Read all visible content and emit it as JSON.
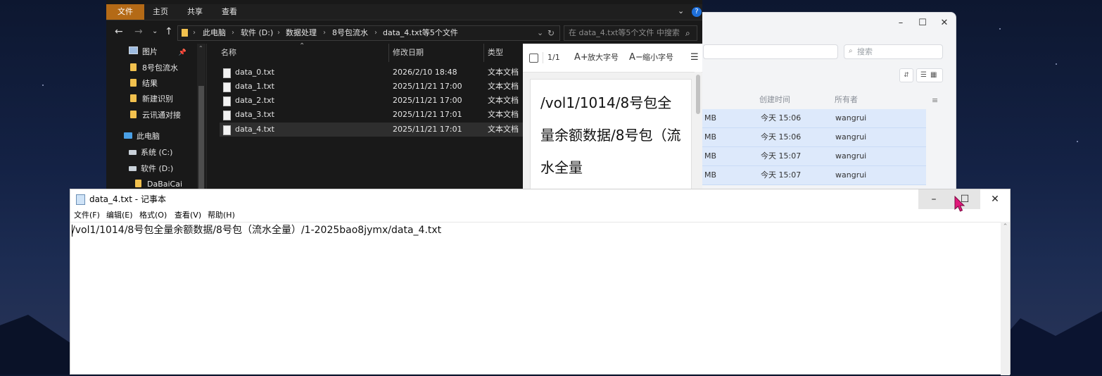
{
  "colors": {
    "accent_file_tab": "#b46a16",
    "explorer_bg": "#191919",
    "selection_row": "#dde9fb",
    "cursor": "#e0187a"
  },
  "background_window": {
    "search_placeholder": "搜索",
    "columns": [
      "创建时间",
      "所有者"
    ],
    "rows": [
      {
        "size": "MB",
        "created": "今天 15:06",
        "owner": "wangrui"
      },
      {
        "size": "MB",
        "created": "今天 15:06",
        "owner": "wangrui"
      },
      {
        "size": "MB",
        "created": "今天 15:07",
        "owner": "wangrui"
      },
      {
        "size": "MB",
        "created": "今天 15:07",
        "owner": "wangrui"
      }
    ],
    "controls": {
      "minimize": "–",
      "maximize": "☐",
      "close": "✕"
    }
  },
  "explorer": {
    "ribbon_tabs": [
      "文件",
      "主页",
      "共享",
      "查看"
    ],
    "breadcrumb": [
      "此电脑",
      "软件 (D:)",
      "数据处理",
      "8号包流水",
      "data_4.txt等5个文件"
    ],
    "search_placeholder": "在 data_4.txt等5个文件 中搜索",
    "sidebar": [
      {
        "label": "图片",
        "icon": "pictures-icon"
      },
      {
        "label": "8号包流水",
        "icon": "folder-icon"
      },
      {
        "label": "结果",
        "icon": "folder-icon"
      },
      {
        "label": "新建识别",
        "icon": "folder-icon"
      },
      {
        "label": "云讯通对接",
        "icon": "folder-icon"
      },
      {
        "label": "此电脑",
        "icon": "computer-icon"
      },
      {
        "label": "系统 (C:)",
        "icon": "drive-icon"
      },
      {
        "label": "软件 (D:)",
        "icon": "drive-icon"
      },
      {
        "label": "DaBaiCai",
        "icon": "folder-icon"
      }
    ],
    "columns": {
      "name": "名称",
      "date": "修改日期",
      "type": "类型"
    },
    "files": [
      {
        "name": "data_0.txt",
        "date": "2026/2/10 18:48",
        "type": "文本文档"
      },
      {
        "name": "data_1.txt",
        "date": "2025/11/21 17:00",
        "type": "文本文档"
      },
      {
        "name": "data_2.txt",
        "date": "2025/11/21 17:00",
        "type": "文本文档"
      },
      {
        "name": "data_3.txt",
        "date": "2025/11/21 17:01",
        "type": "文本文档"
      },
      {
        "name": "data_4.txt",
        "date": "2025/11/21 17:01",
        "type": "文本文档"
      }
    ],
    "preview": {
      "page": "1/1",
      "enlarge": "放大字号",
      "shrink": "缩小字号",
      "text": "/vol1/1014/8号包全量余额数据/8号包（流水全量"
    }
  },
  "notepad": {
    "title": "data_4.txt - 记事本",
    "menu": [
      "文件(F)",
      "编辑(E)",
      "格式(O)",
      "查看(V)",
      "帮助(H)"
    ],
    "content": "/vol1/1014/8号包全量余额数据/8号包（流水全量）/1-2025bao8jymx/data_4.txt",
    "controls": {
      "minimize": "–",
      "maximize": "☐",
      "close": "✕"
    }
  }
}
